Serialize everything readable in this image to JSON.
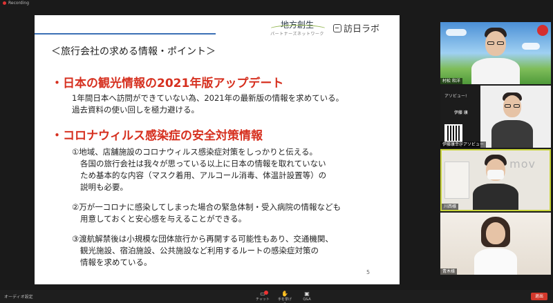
{
  "topbar": {
    "recording_label": "Recording"
  },
  "slide": {
    "logo_chiho_main": "地方創生",
    "logo_chiho_sub": "パートナーズネットワーク",
    "logo_houn": "訪日ラボ",
    "title": "＜旅行会社の求める情報・ポイント＞",
    "heading1": "・日本の観光情報の2021年版アップデート",
    "body1_line1": "1年間日本へ訪問ができていない為、2021年の最新版の情報を求めている。",
    "body1_line2": "過去資料の使い回しを極力避ける。",
    "heading2": "・コロナウィルス感染症の安全対策情報",
    "item1_line1": "①地域、店舗施設のコロナウィルス感染症対策をしっかりと伝える。",
    "item1_line2": "各国の旅行会社は我々が思っている以上に日本の情報を取れていない",
    "item1_line3": "ため基本的な内容（マスク着用、アルコール消毒、体温計設置等）の",
    "item1_line4": "説明も必要。",
    "item2_line1": "②万が一コロナに感染してしまった場合の緊急体制・受入病院の情報なども",
    "item2_line2": "用意しておくと安心感を与えることができる。",
    "item3_line1": "③渡航解禁後は小規模な団体旅行から再開する可能性もあり、交通機関、",
    "item3_line2": "観光施設、宿泊施設、公共施設など利用するルートの感染症対策の",
    "item3_line3": "情報を求めている。",
    "page_number": "5"
  },
  "participants": [
    {
      "name": "村松 和洋"
    },
    {
      "name": "伊藤康幸＠アソビュー",
      "side_brand": "アソビュー!",
      "side_name": "伊藤 康"
    },
    {
      "name": "川西様",
      "bg_text": "mov"
    },
    {
      "name": "青木様"
    }
  ],
  "bottombar": {
    "audio_label": "オーディオ設定",
    "chat_label": "チャット",
    "hand_label": "手を挙げる",
    "qa_label": "Q&A",
    "leave_label": "退出",
    "chat_badge_count": "1"
  },
  "colors": {
    "heading_red": "#d6301f",
    "accent_blue": "#3a6fb5",
    "leave_red": "#d3382b",
    "active_speaker": "#c8d33a"
  }
}
